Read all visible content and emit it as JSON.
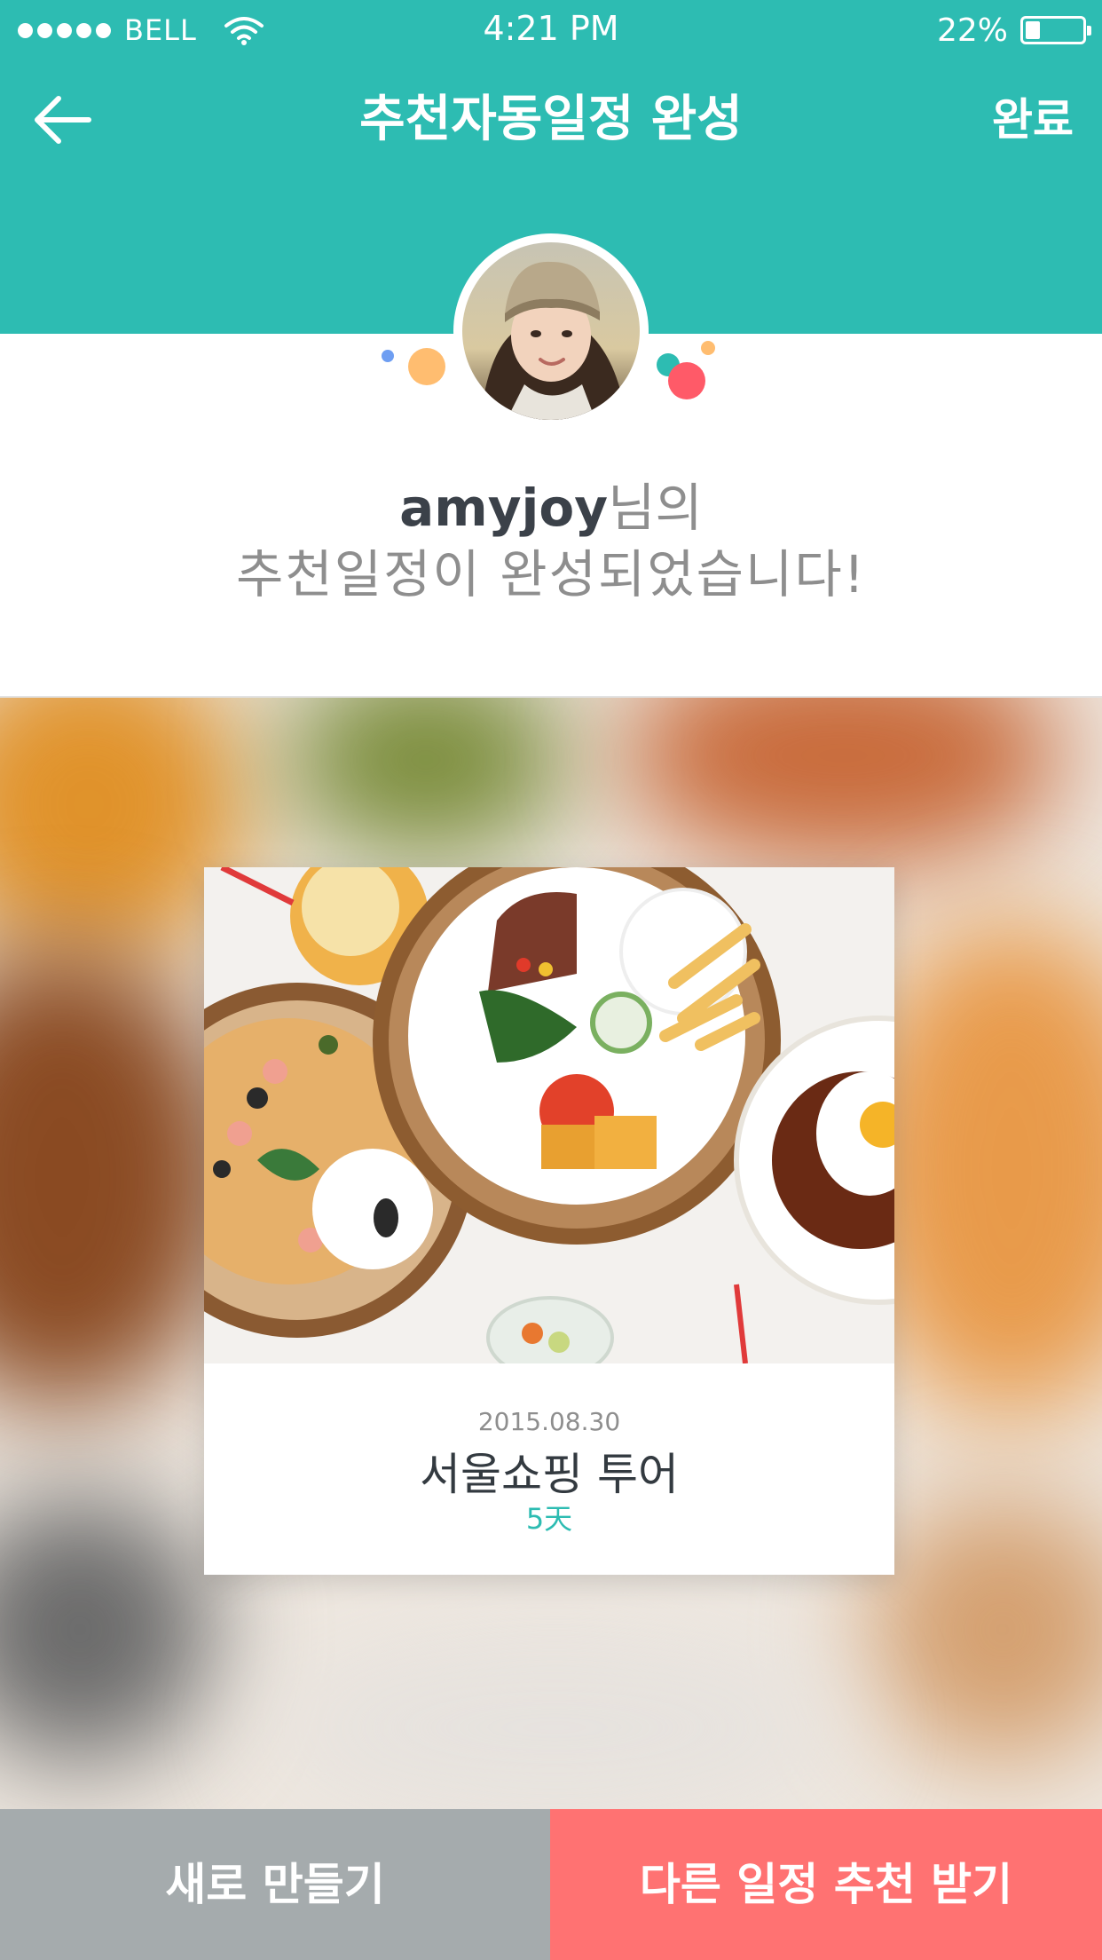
{
  "status_bar": {
    "carrier": "BELL",
    "time": "4:21 PM",
    "battery": "22%"
  },
  "nav": {
    "title": "추천자동일정 완성",
    "done": "완료"
  },
  "greeting": {
    "username": "amyjoy",
    "suffix": "님의",
    "message": "추천일정이 완성되었습니다!"
  },
  "card": {
    "date": "2015.08.30",
    "title": "서울쇼핑 투어",
    "days": "5天"
  },
  "buttons": {
    "new": "새로 만들기",
    "other": "다른 일정 추천 받기"
  },
  "colors": {
    "accent": "#2dbcb2",
    "button_gray": "#a5abad",
    "button_red": "#ff7272"
  }
}
